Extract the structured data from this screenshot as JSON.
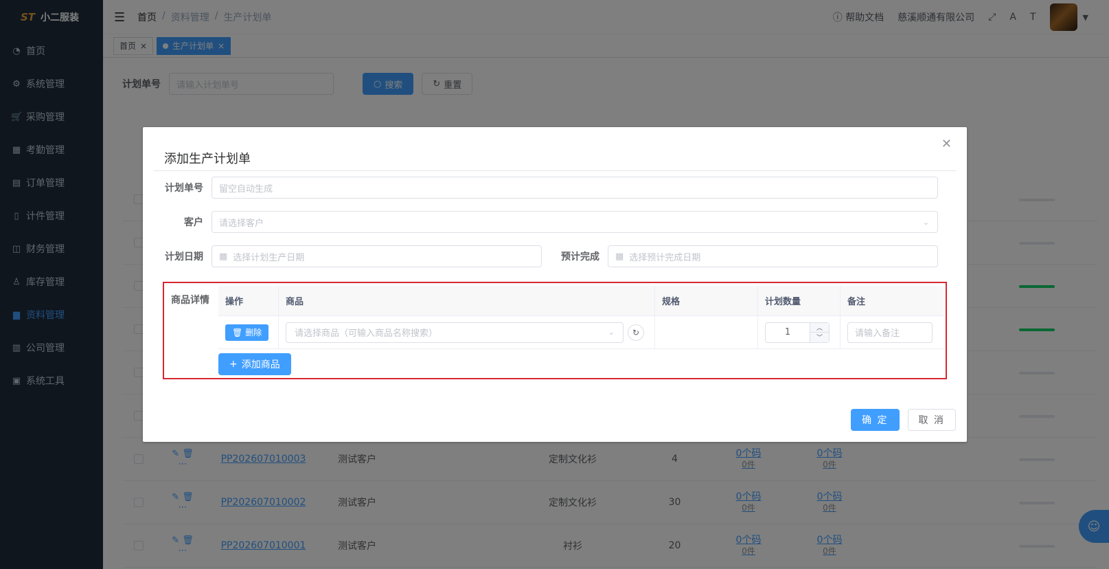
{
  "app": {
    "logo_text": "小二服装",
    "logo_mark": "ST"
  },
  "sidebar": {
    "items": [
      {
        "label": "首页",
        "icon": "dashboard-icon",
        "glyph": "◔"
      },
      {
        "label": "系统管理",
        "icon": "gear-icon",
        "glyph": "⚙"
      },
      {
        "label": "采购管理",
        "icon": "cart-icon",
        "glyph": "🛒"
      },
      {
        "label": "考勤管理",
        "icon": "grid-icon",
        "glyph": "▦"
      },
      {
        "label": "订单管理",
        "icon": "form-icon",
        "glyph": "▤"
      },
      {
        "label": "计件管理",
        "icon": "book-icon",
        "glyph": "▯"
      },
      {
        "label": "财务管理",
        "icon": "chart-icon",
        "glyph": "◫"
      },
      {
        "label": "库存管理",
        "icon": "user-icon",
        "glyph": "♙"
      },
      {
        "label": "资料管理",
        "icon": "document-icon",
        "glyph": "▆"
      },
      {
        "label": "公司管理",
        "icon": "bar-chart-icon",
        "glyph": "▥"
      },
      {
        "label": "系统工具",
        "icon": "toolbox-icon",
        "glyph": "▣"
      }
    ],
    "active_index": 8
  },
  "topbar": {
    "breadcrumb": [
      "首页",
      "资料管理",
      "生产计划单"
    ],
    "help": "帮助文档",
    "company": "慈溪顺通有限公司"
  },
  "tags": {
    "home": "首页",
    "current": "生产计划单"
  },
  "search": {
    "label": "计划单号",
    "placeholder": "请输入计划单号",
    "search_btn": "搜索",
    "reset_btn": "重置"
  },
  "bg_table": {
    "header_last": "预计完成",
    "rows": [
      {
        "no": "PP202607010003",
        "customer": "测试客户",
        "product": "定制文化衫",
        "qty": "4",
        "a": "0个码",
        "a_sub": "0件",
        "b": "0个码",
        "b_sub": "0件"
      },
      {
        "no": "PP202607010002",
        "customer": "测试客户",
        "product": "定制文化衫",
        "qty": "30",
        "a": "0个码",
        "a_sub": "0件",
        "b": "0个码",
        "b_sub": "0件"
      },
      {
        "no": "PP202607010001",
        "customer": "测试客户",
        "product": "衬衫",
        "qty": "20",
        "a": "0个码",
        "a_sub": "0件",
        "b": "0个码",
        "b_sub": "0件"
      }
    ]
  },
  "dialog": {
    "title": "添加生产计划单",
    "fields": {
      "plan_no": {
        "label": "计划单号",
        "placeholder": "留空自动生成"
      },
      "customer": {
        "label": "客户",
        "placeholder": "请选择客户"
      },
      "plan_date": {
        "label": "计划日期",
        "placeholder": "选择计划生产日期"
      },
      "finish_date": {
        "label": "预计完成",
        "placeholder": "选择预计完成日期"
      }
    },
    "details": {
      "label": "商品详情",
      "columns": [
        "操作",
        "商品",
        "规格",
        "计划数量",
        "备注"
      ],
      "delete_btn": "删除",
      "product_placeholder": "请选择商品（可输入商品名称搜索）",
      "qty": "1",
      "note_placeholder": "请输入备注",
      "add_btn": "添加商品"
    },
    "ok": "确 定",
    "cancel": "取 消"
  }
}
